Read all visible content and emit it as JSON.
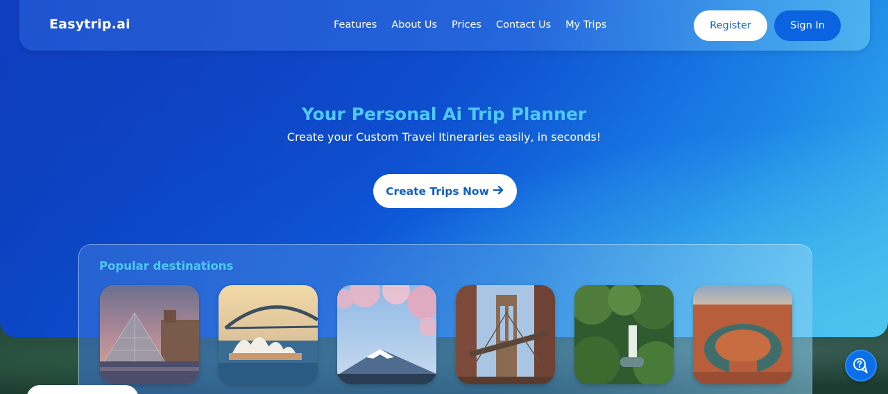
{
  "brand": {
    "logo_text": "Easytrip.ai"
  },
  "nav": {
    "links": [
      "Features",
      "About Us",
      "Prices",
      "Contact Us",
      "My Trips"
    ],
    "register_label": "Register",
    "signin_label": "Sign In"
  },
  "hero": {
    "title": "Your Personal Ai Trip Planner",
    "subtitle": "Create your Custom Travel Itineraries easily, in seconds!",
    "cta_label": "Create Trips Now",
    "cta_icon": "arrow-right-icon"
  },
  "destinations": {
    "heading": "Popular destinations",
    "items": [
      {
        "image": "louvre-pyramid-photo"
      },
      {
        "image": "sydney-opera-house-photo"
      },
      {
        "image": "mount-fuji-cherry-blossom-photo"
      },
      {
        "image": "manhattan-bridge-photo"
      },
      {
        "image": "jungle-waterfall-photo"
      },
      {
        "image": "horseshoe-bend-photo"
      }
    ]
  },
  "help": {
    "icon": "chat-help-icon"
  },
  "colors": {
    "accent_title": "#4fc9f5",
    "primary_button": "#0b63e0",
    "hero_gradient_start": "#0b3bb8",
    "hero_gradient_end": "#3ab6ee"
  }
}
